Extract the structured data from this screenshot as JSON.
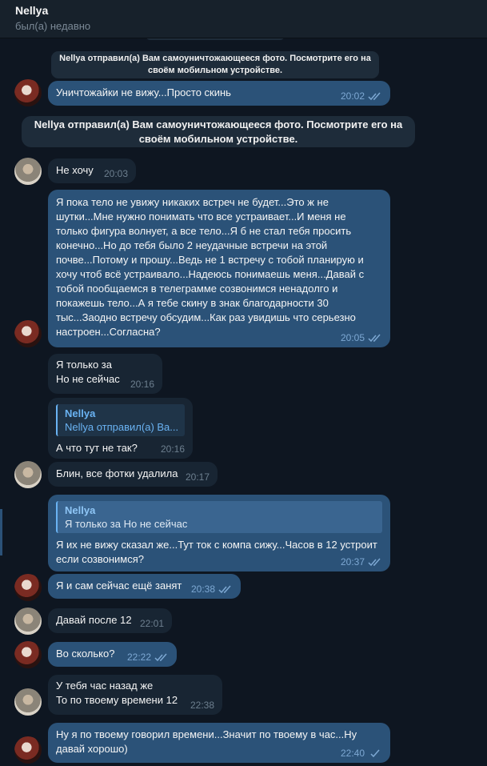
{
  "header": {
    "name": "Nellya",
    "status": "был(а) недавно"
  },
  "service": {
    "top": "Nellya отправил(а) Вам самоуничтожающееся фото. Посмотрите его на своём мобильном устройстве.",
    "middle": "Nellya отправил(а) Вам самоуничтожающееся фото. Посмотрите его на своём мобильном устройстве."
  },
  "messages": [
    {
      "text": "Уничтожайки не вижу...Просто скинь",
      "time": "20:02"
    },
    {
      "text": "Не хочу",
      "time": "20:03"
    },
    {
      "text": "Я пока тело не увижу никаких встреч не будет...Это ж не\nшутки...Мне нужно понимать что все устраивает...И меня не\nтолько фигура волнует, а все тело...Я б не стал тебя просить\nконечно...Но до тебя было 2 неудачные встречи на этой\nпочве...Потому и прошу...Ведь не 1 встречу с тобой планирую и\nхочу чтоб всё устраивало...Надеюсь понимаешь меня...Давай с\nтобой пообщаемся в  телеграмме созвонимся ненадолго и\nпокажешь тело...А я тебе скину в знак благодарности 30\nтыс...Заодно встречу обсудим...Как раз увидишь что серьезно\nнастроен...Согласна?",
      "time": "20:05"
    },
    {
      "text": "Я только за\nНо не сейчас",
      "time": "20:16"
    },
    {
      "reply_name": "Nellya",
      "reply_text": "Nellya отправил(а) Ва...",
      "text": "А что тут не так?",
      "time": "20:16"
    },
    {
      "text": "Блин, все фотки удалила",
      "time": "20:17"
    },
    {
      "reply_name": "Nellya",
      "reply_text": "Я только за  Но не сейчас",
      "text": "Я их не вижу сказал же...Тут ток с компа сижу...Часов в 12 устроит\nесли созвонимся?",
      "time": "20:37"
    },
    {
      "text": "Я и сам сейчас ещё занят",
      "time": "20:38"
    },
    {
      "text": "Давай после 12",
      "time": "22:01"
    },
    {
      "text": "Во сколько?",
      "time": "22:22"
    },
    {
      "text": "У тебя час назад же\nТо по твоему времени 12",
      "time": "22:38"
    },
    {
      "text": "Ну я по твоему говорил времени...Значит по твоему в час...Ну\nдавай хорошо)",
      "time": "22:40"
    }
  ],
  "icons": {
    "read": "double-check-icon",
    "sent": "single-check-icon"
  },
  "colors": {
    "outgoing": "#2b5278",
    "incoming": "#182533",
    "background": "#0e1621",
    "accent": "#6ab3f3"
  }
}
